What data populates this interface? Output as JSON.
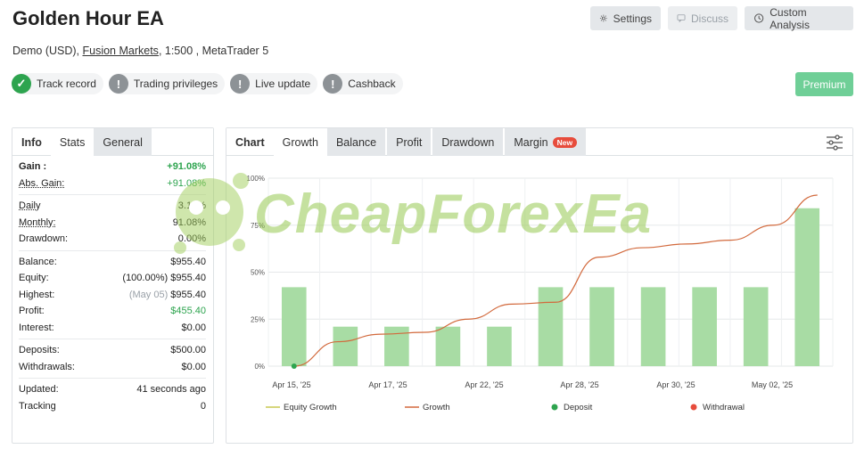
{
  "header": {
    "title": "Golden Hour EA",
    "settings_label": "Settings",
    "discuss_label": "Discuss",
    "custom_analysis_label": "Custom Analysis"
  },
  "account": {
    "prefix": "Demo (USD), ",
    "broker": "Fusion Markets",
    "suffix": ", 1:500 , MetaTrader 5"
  },
  "badges": [
    {
      "label": "Track record",
      "icon": "check-icon",
      "status": "ok"
    },
    {
      "label": "Trading privileges",
      "icon": "exclamation-icon",
      "status": "warn"
    },
    {
      "label": "Live update",
      "icon": "exclamation-icon",
      "status": "warn"
    },
    {
      "label": "Cashback",
      "icon": "exclamation-icon",
      "status": "warn"
    }
  ],
  "premium_label": "Premium",
  "left_tabs": [
    "Info",
    "Stats",
    "General"
  ],
  "stats": {
    "gain_label": "Gain :",
    "gain_value": "+91.08%",
    "abs_gain_label": "Abs. Gain:",
    "abs_gain_value": "+91.08%",
    "daily_label": "Daily",
    "daily_value": "3.13%",
    "monthly_label": "Monthly:",
    "monthly_value": "91.08%",
    "drawdown_label": "Drawdown:",
    "drawdown_value": "0.00%",
    "balance_label": "Balance:",
    "balance_value": "$955.40",
    "equity_label": "Equity:",
    "equity_note": "(100.00%)",
    "equity_value": "$955.40",
    "highest_label": "Highest:",
    "highest_note": "(May 05)",
    "highest_value": "$955.40",
    "profit_label": "Profit:",
    "profit_value": "$455.40",
    "interest_label": "Interest:",
    "interest_value": "$0.00",
    "deposits_label": "Deposits:",
    "deposits_value": "$500.00",
    "withdrawals_label": "Withdrawals:",
    "withdrawals_value": "$0.00",
    "updated_label": "Updated:",
    "updated_value": "41 seconds ago",
    "tracking_label": "Tracking",
    "tracking_value": "0"
  },
  "chart_tabs": {
    "chart": "Chart",
    "growth": "Growth",
    "balance": "Balance",
    "profit": "Profit",
    "drawdown": "Drawdown",
    "margin": "Margin",
    "new_badge": "New"
  },
  "watermark_text": "CheapForexEa",
  "colors": {
    "bar": "#a8dca4",
    "growth_line": "#d2693c",
    "equity_line": "#c8c850",
    "deposit": "#2ea44f",
    "withdrawal": "#e74c3c",
    "premium": "#6fcf97",
    "positive": "#2ea44f"
  },
  "chart_data": {
    "type": "bar",
    "y_ticks": [
      "0%",
      "25%",
      "50%",
      "75%",
      "100%"
    ],
    "ylim": [
      0,
      100
    ],
    "x_tick_labels": [
      "Apr 15, '25",
      "Apr 17, '25",
      "Apr 22, '25",
      "Apr 28, '25",
      "Apr 30, '25",
      "May 02, '25"
    ],
    "bars": [
      42,
      21,
      21,
      21,
      21,
      42,
      42,
      42,
      42,
      42,
      84
    ],
    "growth": [
      0,
      13,
      17,
      18,
      25,
      33,
      34,
      58,
      63,
      65,
      67,
      75,
      91
    ],
    "deposit_point": {
      "y": 0
    },
    "legend": [
      "Equity Growth",
      "Growth",
      "Deposit",
      "Withdrawal"
    ]
  }
}
